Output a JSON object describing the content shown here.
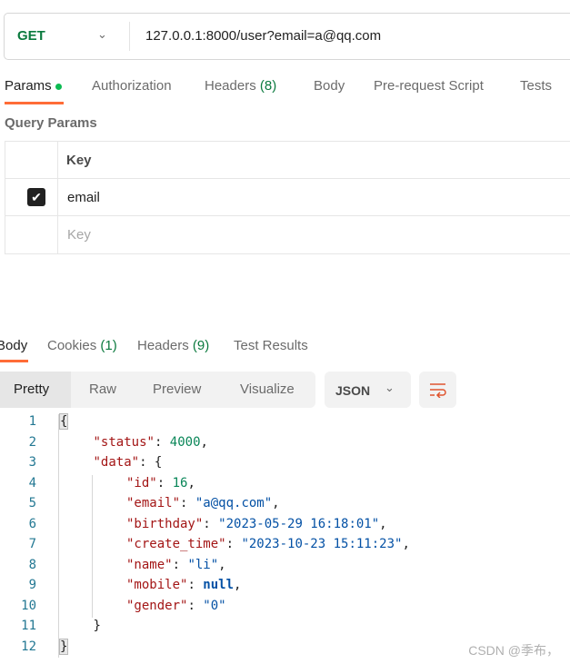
{
  "request": {
    "method": "GET",
    "url": "127.0.0.1:8000/user?email=a@qq.com"
  },
  "request_tabs": [
    {
      "label": "Params",
      "active": true
    },
    {
      "label": "Authorization"
    },
    {
      "label": "Headers",
      "count": "(8)"
    },
    {
      "label": "Body"
    },
    {
      "label": "Pre-request Script"
    },
    {
      "label": "Tests"
    }
  ],
  "query_params": {
    "title": "Query Params",
    "header_key": "Key",
    "rows": [
      {
        "key": "email",
        "checked": true
      }
    ],
    "placeholder": "Key"
  },
  "response_tabs": [
    {
      "label": "Body",
      "active": true
    },
    {
      "label": "Cookies",
      "count": "(1)"
    },
    {
      "label": "Headers",
      "count": "(9)"
    },
    {
      "label": "Test Results"
    }
  ],
  "view_modes": [
    "Pretty",
    "Raw",
    "Preview",
    "Visualize"
  ],
  "format": "JSON",
  "icons": {
    "wrap": "word-wrap-icon",
    "chevron": "chevron-down-icon",
    "check": "checkbox-checked-icon"
  },
  "colors": {
    "accent": "#ff6c37",
    "method": "#0b7a3e"
  },
  "code_lines": [
    [
      [
        "p",
        "{"
      ]
    ],
    [
      [
        "k",
        "\"status\""
      ],
      [
        "p",
        ": "
      ],
      [
        "n",
        "4000"
      ],
      [
        "p",
        ","
      ]
    ],
    [
      [
        "k",
        "\"data\""
      ],
      [
        "p",
        ": {"
      ]
    ],
    [
      [
        "k",
        "\"id\""
      ],
      [
        "p",
        ": "
      ],
      [
        "n",
        "16"
      ],
      [
        "p",
        ","
      ]
    ],
    [
      [
        "k",
        "\"email\""
      ],
      [
        "p",
        ": "
      ],
      [
        "s",
        "\"a@qq.com\""
      ],
      [
        "p",
        ","
      ]
    ],
    [
      [
        "k",
        "\"birthday\""
      ],
      [
        "p",
        ": "
      ],
      [
        "s",
        "\"2023-05-29 16:18:01\""
      ],
      [
        "p",
        ","
      ]
    ],
    [
      [
        "k",
        "\"create_time\""
      ],
      [
        "p",
        ": "
      ],
      [
        "s",
        "\"2023-10-23 15:11:23\""
      ],
      [
        "p",
        ","
      ]
    ],
    [
      [
        "k",
        "\"name\""
      ],
      [
        "p",
        ": "
      ],
      [
        "s",
        "\"li\""
      ],
      [
        "p",
        ","
      ]
    ],
    [
      [
        "k",
        "\"mobile\""
      ],
      [
        "p",
        ": "
      ],
      [
        "nl",
        "null"
      ],
      [
        "p",
        ","
      ]
    ],
    [
      [
        "k",
        "\"gender\""
      ],
      [
        "p",
        ": "
      ],
      [
        "s",
        "\"0\""
      ]
    ],
    [
      [
        "p",
        "}"
      ]
    ],
    [
      [
        "p",
        "}"
      ]
    ]
  ],
  "code_indent": [
    0,
    1,
    1,
    2,
    2,
    2,
    2,
    2,
    2,
    2,
    1,
    0
  ],
  "watermark": "CSDN @季布，"
}
